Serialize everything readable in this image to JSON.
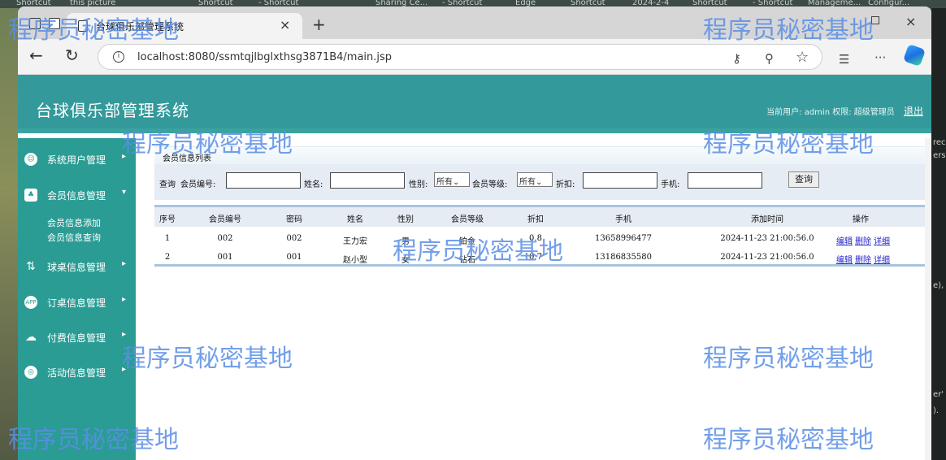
{
  "desktop": {
    "strip_items": [
      "Shortcut",
      "this picture",
      "Shortcut",
      "- Shortcut",
      "Sharing Ce...",
      "- Shortcut",
      "Edge",
      "Shortcut",
      "2024-2-4",
      "Shortcut",
      "- Shortcut",
      "Manageme...",
      "Configur..."
    ],
    "right_edge": [
      "rec",
      "ers",
      "e),",
      "er'",
      ")."
    ]
  },
  "browser": {
    "tab_title": "台球俱乐部管理系统",
    "tab_close": "×",
    "new_tab": "+",
    "window_close": "×",
    "back": "←",
    "refresh": "↻",
    "url": "localhost:8080/ssmtqjlbglxthsg3871B4/main.jsp",
    "more": "···"
  },
  "app": {
    "title": "台球俱乐部管理系统",
    "current_user_label": "当前用户:",
    "current_user": "admin",
    "role_label": "权限:",
    "role": "超级管理员",
    "logout": "退出"
  },
  "sidebar": {
    "items": [
      {
        "label": "系统用户管理",
        "arrow": "▸",
        "icon": "user-icon"
      },
      {
        "label": "会员信息管理",
        "arrow": "▾",
        "icon": "member-icon"
      },
      {
        "label": "球桌信息管理",
        "arrow": "▸",
        "icon": "table-icon"
      },
      {
        "label": "订桌信息管理",
        "arrow": "▸",
        "icon": "app-icon"
      },
      {
        "label": "付费信息管理",
        "arrow": "▸",
        "icon": "cloud-icon"
      },
      {
        "label": "活动信息管理",
        "arrow": "▸",
        "icon": "settings-icon"
      }
    ],
    "submenu": [
      "会员信息添加",
      "会员信息查询"
    ]
  },
  "panel": {
    "title": "会员信息列表"
  },
  "search": {
    "query_label": "查询",
    "member_no_label": "会员编号:",
    "name_label": "姓名:",
    "gender_label": "性别:",
    "gender_value": "所有",
    "level_label": "会员等级:",
    "level_value": "所有",
    "discount_label": "折扣:",
    "phone_label": "手机:",
    "button": "查询"
  },
  "table": {
    "headers": [
      "序号",
      "会员编号",
      "密码",
      "姓名",
      "性别",
      "会员等级",
      "折扣",
      "手机",
      "添加时间",
      "操作"
    ],
    "rows": [
      {
        "index": "1",
        "member_no": "002",
        "password": "002",
        "name": "王力宏",
        "gender": "男",
        "level": "铂金",
        "discount": "0.8",
        "phone": "13658996477",
        "added": "2024-11-23 21:00:56.0"
      },
      {
        "index": "2",
        "member_no": "001",
        "password": "001",
        "name": "赵小型",
        "gender": "女",
        "level": "钻石",
        "discount": "0.7",
        "phone": "13186835580",
        "added": "2024-11-23 21:00:56.0"
      }
    ],
    "ops": {
      "edit": "编辑",
      "delete": "删除",
      "detail": "详细"
    }
  },
  "watermark": "程序员秘密基地"
}
